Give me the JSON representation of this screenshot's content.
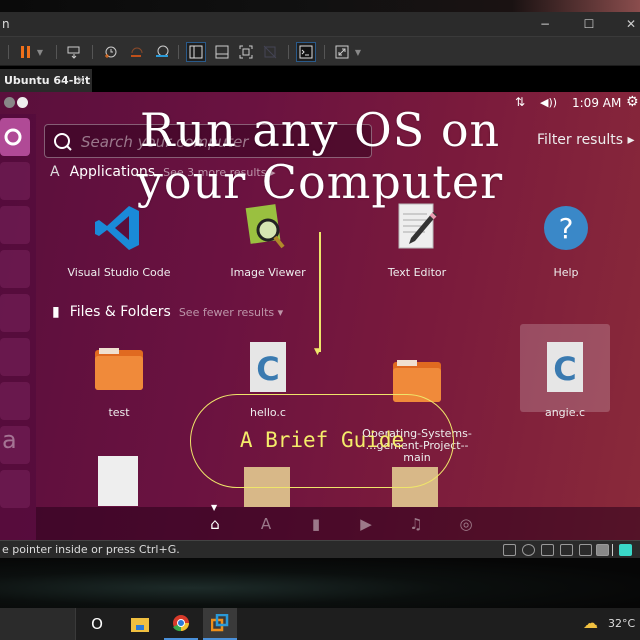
{
  "window": {
    "title": "n",
    "minimize": "−",
    "maximize": "☐",
    "close": "✕"
  },
  "toolbar": {
    "items": [
      "pause",
      "pause-dropdown",
      "send-ctrl-alt-del",
      "take-snapshot",
      "revert-snapshot",
      "manage-snapshots",
      "show-library",
      "thumbnail-bar",
      "fullscreen",
      "unity",
      "console-view",
      "stretch-guest",
      "stretch-dropdown"
    ]
  },
  "tabs": [
    {
      "label": "Ubuntu 64-bit",
      "close": "✕"
    }
  ],
  "ubuntu": {
    "panel": {
      "time": "1:09 AM",
      "network": "⇅",
      "volume": "◀))",
      "settings": "⚙"
    },
    "search": {
      "placeholder": "Search your computer"
    },
    "filter_label": "Filter results ▸",
    "applications": {
      "title": "Applications",
      "more": "See 3 more results ▸",
      "items": [
        {
          "label": "Visual Studio Code"
        },
        {
          "label": "Image Viewer"
        },
        {
          "label": "Text Editor"
        },
        {
          "label": "Help"
        }
      ]
    },
    "files": {
      "title": "Files & Folders",
      "more": "See fewer results ▾",
      "items": [
        {
          "label": "test"
        },
        {
          "label": "hello.c"
        },
        {
          "label": "Operating-Systems-\n…gement-Project--main"
        },
        {
          "label": "angie.c"
        }
      ]
    },
    "dash_lenses": [
      "home",
      "applications",
      "files",
      "video",
      "music",
      "photos"
    ]
  },
  "overlay": {
    "line1": "Run any OS on",
    "line2": "your Computer",
    "guide": "A Brief Guide"
  },
  "statusbar": {
    "text": "e pointer inside or press Ctrl+G."
  },
  "taskbar": {
    "search_glyph": "O",
    "weather": "32°C",
    "colors": {
      "accent": "#4a90d9"
    }
  }
}
